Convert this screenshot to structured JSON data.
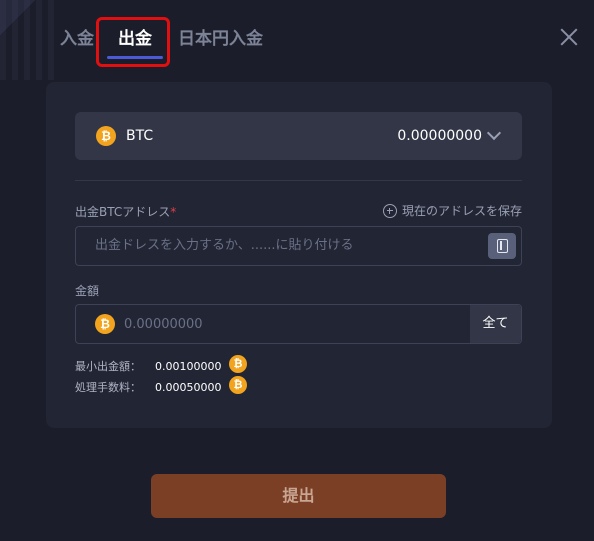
{
  "tabs": {
    "deposit": "入金",
    "withdraw": "出金",
    "jpy_deposit": "日本円入金"
  },
  "coin": {
    "symbol_glyph": "₿",
    "name": "BTC",
    "balance": "0.00000000"
  },
  "address": {
    "label": "出金BTCアドレス",
    "required_mark": "*",
    "save_label": "現在のアドレスを保存",
    "placeholder": "出金ドレスを入力するか、......に貼り付ける"
  },
  "amount": {
    "label": "金額",
    "placeholder": "0.00000000",
    "all_label": "全て"
  },
  "fees": {
    "min_label": "最小出金額：",
    "min_value": "0.00100000",
    "fee_label": "処理手数料：",
    "fee_value": "0.00050000"
  },
  "submit_label": "提出",
  "colors": {
    "accent": "#4b5bd8",
    "coin": "#f2a41f",
    "submit": "#7a3f25",
    "highlight": "#e01010"
  }
}
